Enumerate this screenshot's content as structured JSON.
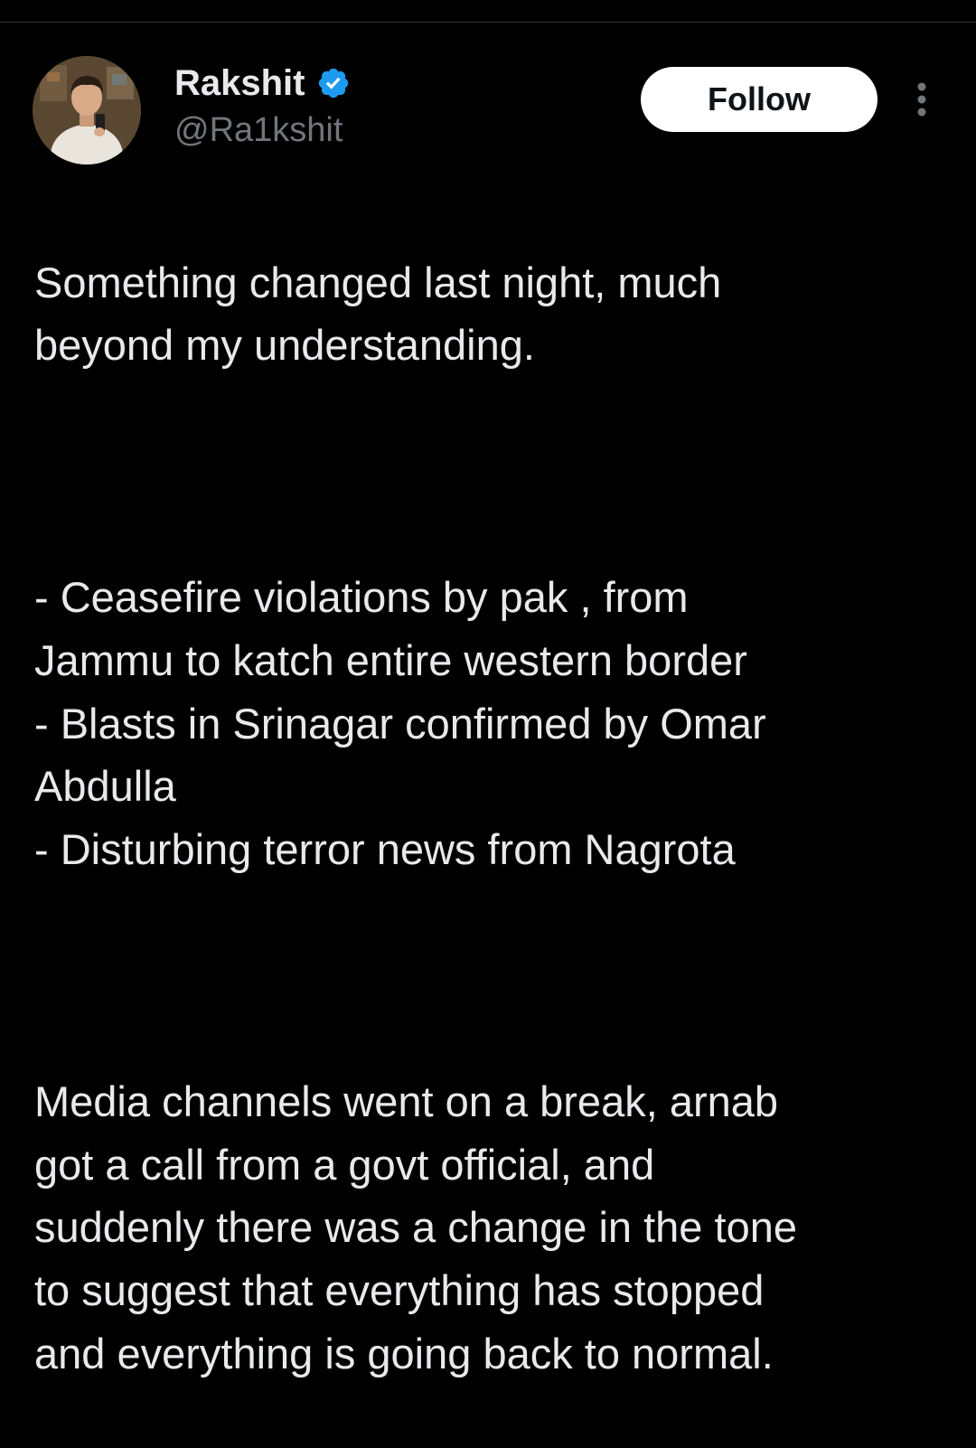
{
  "tweet": {
    "author": {
      "display_name": "Rakshit",
      "handle": "@Ra1kshit",
      "verified": true,
      "avatar_icon": "user-avatar"
    },
    "follow_label": "Follow",
    "more_icon": "more-vertical-icon",
    "paragraphs": [
      "Something changed last night, much\nbeyond my understanding.",
      "- Ceasefire violations by pak , from\nJammu to katch entire western border\n- Blasts in Srinagar confirmed by Omar\nAbdulla\n- Disturbing terror news from Nagrota",
      "Media channels went on a break, arnab\ngot a call from a govt official, and\nsuddenly there was a change in the tone\nto suggest that everything has stopped\nand everything is going back to normal."
    ]
  },
  "colors": {
    "background": "#000000",
    "text_primary": "#e7e9ea",
    "text_secondary": "#71767b",
    "verified_badge": "#1d9bf0",
    "follow_bg": "#ffffff",
    "follow_text": "#0f1419"
  }
}
